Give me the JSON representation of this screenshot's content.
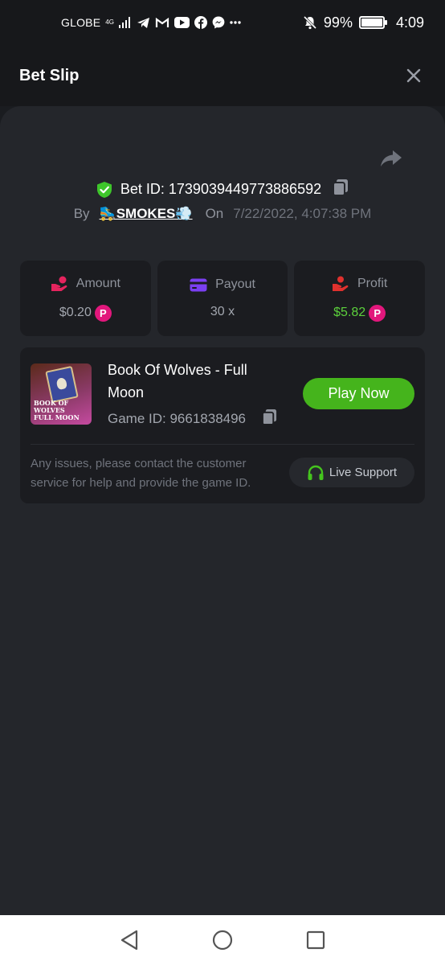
{
  "status_bar": {
    "carrier": "GLOBE",
    "network": "4G",
    "battery": "99%",
    "battery_level": 0.99,
    "time": "4:09",
    "icons": [
      "signal-icon",
      "telegram-icon",
      "gmail-icon",
      "youtube-icon",
      "facebook-icon",
      "messenger-icon",
      "more-icon",
      "bell-off-icon",
      "battery-icon"
    ]
  },
  "header": {
    "title": "Bet Slip",
    "close_icon": "close-icon"
  },
  "bet": {
    "id_text": "Bet ID: 1739039449773886592",
    "by_label": "By",
    "user": "🛼SMOKES💨",
    "on_label": "On",
    "date": "7/22/2022, 4:07:38 PM"
  },
  "stats": [
    {
      "title": "Amount",
      "value": "$0.20",
      "icon": "hand-coin-icon",
      "icon_color": "#e5245e",
      "coin": true
    },
    {
      "title": "Payout",
      "value": "30 x",
      "icon": "card-icon",
      "icon_color": "#7b3ff2",
      "coin": false
    },
    {
      "title": "Profit",
      "value": "$5.82",
      "icon": "profit-hand-icon",
      "icon_color": "#e0312e",
      "coin": true
    }
  ],
  "coin_symbol": "P",
  "game": {
    "name": "Book Of Wolves - Full Moon",
    "id_text": "Game ID: 9661838496",
    "thumb_line1": "BOOK OF WOLVES",
    "thumb_line2": "FULL MOON",
    "play_label": "Play Now",
    "help_text": "Any issues, please contact the customer service for help and provide the game ID.",
    "support_label": "Live Support"
  },
  "colors": {
    "accent_green": "#45b41c",
    "profit_green": "#5cd13c",
    "coin_pink": "#e2177c",
    "shield_green": "#3ec62b"
  }
}
